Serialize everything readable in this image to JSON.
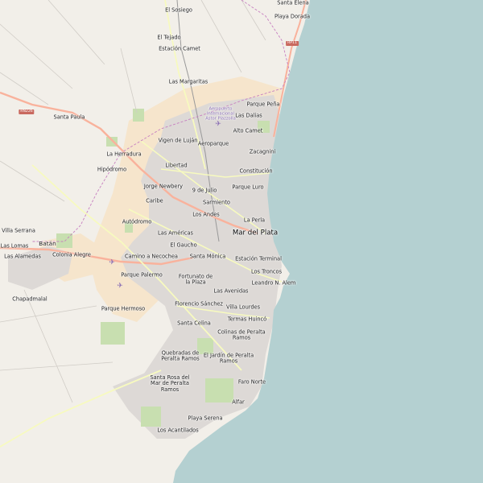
{
  "colors": {
    "sea": "#b4d0d1",
    "land": "#f2efe9",
    "urban": "#ddd9d6",
    "farmland": "#f6e5cc",
    "park": "#c8dfb0",
    "primary_road": "#f9b29c",
    "secondary_road": "#f7fabf",
    "boundary": "#c77fc0",
    "airport_label": "#8a6fb5"
  },
  "icons": {
    "airport": "airplane-icon"
  },
  "places": [
    {
      "id": "santa-elena",
      "name": "Santa Elena",
      "kind": "place"
    },
    {
      "id": "el-sosiego",
      "name": "El Sosiego",
      "kind": "place"
    },
    {
      "id": "playa-dorada",
      "name": "Playa Dorada",
      "kind": "place"
    },
    {
      "id": "el-tejado",
      "name": "El Tejado",
      "kind": "place"
    },
    {
      "id": "estacion-camet",
      "name": "Estación Camet",
      "kind": "place"
    },
    {
      "id": "las-margaritas",
      "name": "Las Margaritas",
      "kind": "place"
    },
    {
      "id": "parque-pena",
      "name": "Parque Peña",
      "kind": "place"
    },
    {
      "id": "santa-paula",
      "name": "Santa Paula",
      "kind": "place"
    },
    {
      "id": "aeropuerto-label",
      "name": "Aeropuerto\nInternacional\nAstor Piazzolla",
      "kind": "airport"
    },
    {
      "id": "las-dalias",
      "name": "Las Dalias",
      "kind": "place"
    },
    {
      "id": "alto-camet",
      "name": "Alto Camet",
      "kind": "place"
    },
    {
      "id": "vigen-de-lujan",
      "name": "Vigen de Luján",
      "kind": "place"
    },
    {
      "id": "aeroparque",
      "name": "Aeroparque",
      "kind": "place"
    },
    {
      "id": "zacagnini",
      "name": "Zacagnini",
      "kind": "place"
    },
    {
      "id": "la-herradura",
      "name": "La Herradura",
      "kind": "place"
    },
    {
      "id": "hipodromo",
      "name": "Hipódromo",
      "kind": "place"
    },
    {
      "id": "libertad",
      "name": "Libertad",
      "kind": "place"
    },
    {
      "id": "constitucion",
      "name": "Constitución",
      "kind": "place"
    },
    {
      "id": "jorge-newbery",
      "name": "Jorge Newbery",
      "kind": "place"
    },
    {
      "id": "parque-luro",
      "name": "Parque Luro",
      "kind": "place"
    },
    {
      "id": "9-de-julio",
      "name": "9 de Julio",
      "kind": "place"
    },
    {
      "id": "caribe",
      "name": "Caribe",
      "kind": "place"
    },
    {
      "id": "sarmiento",
      "name": "Sarmiento",
      "kind": "place"
    },
    {
      "id": "los-andes",
      "name": "Los Andes",
      "kind": "place"
    },
    {
      "id": "la-perla",
      "name": "La Perla",
      "kind": "place"
    },
    {
      "id": "autodromo",
      "name": "Autódromo",
      "kind": "place"
    },
    {
      "id": "villa-serrana",
      "name": "Villa Serrana",
      "kind": "place"
    },
    {
      "id": "las-americas",
      "name": "Las Américas",
      "kind": "place"
    },
    {
      "id": "mar-del-plata",
      "name": "Mar del Plata",
      "kind": "city"
    },
    {
      "id": "batan",
      "name": "Batán",
      "kind": "town"
    },
    {
      "id": "las-lomas",
      "name": "Las Lomas",
      "kind": "place"
    },
    {
      "id": "el-gaucho",
      "name": "El Gaucho",
      "kind": "place"
    },
    {
      "id": "colonia-alegre",
      "name": "Colonia Alegre",
      "kind": "place"
    },
    {
      "id": "las-alamedas",
      "name": "Las Alamedas",
      "kind": "place"
    },
    {
      "id": "camino-a-necochea",
      "name": "Camino a Necochea",
      "kind": "place"
    },
    {
      "id": "santa-monica",
      "name": "Santa Mónica",
      "kind": "place"
    },
    {
      "id": "estacion-terminal",
      "name": "Estación Terminal",
      "kind": "place"
    },
    {
      "id": "parque-palermo",
      "name": "Parque Palermo",
      "kind": "place"
    },
    {
      "id": "los-troncos",
      "name": "Los Troncos",
      "kind": "place"
    },
    {
      "id": "fortunato-de-la-plaza",
      "name": "Fortunato de\nla Plaza",
      "kind": "place"
    },
    {
      "id": "leandro-n-alem",
      "name": "Leandro N. Alem",
      "kind": "place"
    },
    {
      "id": "las-avenidas",
      "name": "Las Avenidas",
      "kind": "place"
    },
    {
      "id": "chapadmalal",
      "name": "Chapadmalal",
      "kind": "place"
    },
    {
      "id": "florencio-sanchez",
      "name": "Florencio Sánchez",
      "kind": "place"
    },
    {
      "id": "villa-lourdes",
      "name": "Villa Lourdes",
      "kind": "place"
    },
    {
      "id": "parque-hermoso",
      "name": "Parque Hermoso",
      "kind": "place"
    },
    {
      "id": "termas-huinco",
      "name": "Termas Huincó",
      "kind": "place"
    },
    {
      "id": "santa-celina",
      "name": "Santa Celina",
      "kind": "place"
    },
    {
      "id": "colinas-de-peralta-ramos",
      "name": "Colinas de Peralta\nRamos",
      "kind": "place"
    },
    {
      "id": "quebradas-de-peralta-ramos",
      "name": "Quebradas de\nPeralta Ramos",
      "kind": "place"
    },
    {
      "id": "el-jardin-de-peralta-ramos",
      "name": "El Jardín de Peralta\nRamos",
      "kind": "place"
    },
    {
      "id": "santa-rosa-del-mar",
      "name": "Santa Rosa del\nMar de Peralta\nRamos",
      "kind": "place"
    },
    {
      "id": "faro-norte",
      "name": "Faro Norte",
      "kind": "place"
    },
    {
      "id": "alfar",
      "name": "Alfar",
      "kind": "place"
    },
    {
      "id": "playa-serena",
      "name": "Playa Serena",
      "kind": "place"
    },
    {
      "id": "los-acantilados",
      "name": "Los Acantilados",
      "kind": "place"
    }
  ],
  "road_shields": [
    {
      "id": "rp11-shield",
      "ref": "RP11"
    },
    {
      "id": "rn226-shield",
      "ref": "RN226"
    }
  ]
}
